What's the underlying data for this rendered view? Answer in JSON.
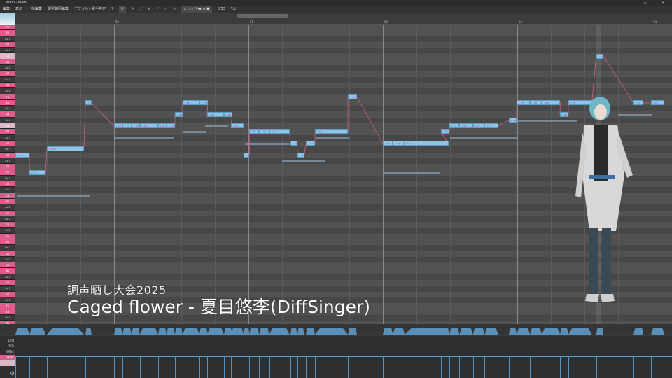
{
  "window": {
    "title": "Main - Main",
    "minimize": "–",
    "maximize": "❐",
    "close": "✕"
  },
  "toolbar": {
    "menus": [
      "編集",
      "表示",
      "一括編集",
      "選択範囲編集",
      "デフォルト歌手設定"
    ],
    "tools": [
      "?",
      "⇱",
      "✎",
      "⟋",
      "✐",
      "⟋",
      "⟋",
      "✎"
    ],
    "group": [
      "♫",
      "▭",
      "⟋",
      "/",
      "▬",
      "⋀",
      "▣"
    ],
    "counter": "0/33",
    "extra": "½♪"
  },
  "ruler": {
    "bars": [
      "50",
      "51",
      "52",
      "53",
      "54"
    ]
  },
  "keys": [
    "F5",
    "E5",
    "D#5",
    "D5",
    "C#5",
    "C5",
    "B4",
    "A#4",
    "A4",
    "G#4",
    "G4",
    "F#4",
    "F4",
    "E4",
    "D#4",
    "D4",
    "C#4",
    "C4",
    "B3",
    "A#3",
    "A3",
    "G#3",
    "G3",
    "F#3",
    "F3",
    "E3",
    "D#3",
    "D3",
    "C#3",
    "C3",
    "B2",
    "A#2",
    "A2",
    "G#2",
    "G2",
    "F#2",
    "F2",
    "E2",
    "D#2",
    "D2",
    "C#2",
    "C2",
    "B1",
    "A#1",
    "A1",
    "G#1",
    "G1",
    "F#1",
    "F1",
    "E1",
    "D#1",
    "D1",
    "C#1"
  ],
  "notes": [
    {
      "pitch": "G3",
      "start": -2.94,
      "len": 0.42
    },
    {
      "pitch": "E3",
      "start": -2.52,
      "len": 0.48
    },
    {
      "pitch": "G#3",
      "start": -2.0,
      "len": 1.1
    },
    {
      "pitch": "E4",
      "start": -0.85,
      "len": 0.18
    },
    {
      "pitch": "C4",
      "start": 0.0,
      "len": 0.25
    },
    {
      "pitch": "C4",
      "start": 0.25,
      "len": 0.27
    },
    {
      "pitch": "C4",
      "start": 0.52,
      "len": 0.25
    },
    {
      "pitch": "C4",
      "start": 0.77,
      "len": 0.54
    },
    {
      "pitch": "C4",
      "start": 1.31,
      "len": 0.25
    },
    {
      "pitch": "C4",
      "start": 1.56,
      "len": 0.25
    },
    {
      "pitch": "D4",
      "start": 1.81,
      "len": 0.23
    },
    {
      "pitch": "E4",
      "start": 2.04,
      "len": 0.5
    },
    {
      "pitch": "E4",
      "start": 2.54,
      "len": 0.25
    },
    {
      "pitch": "D4",
      "start": 2.77,
      "len": 0.5
    },
    {
      "pitch": "D4",
      "start": 3.27,
      "len": 0.25
    },
    {
      "pitch": "C4",
      "start": 3.48,
      "len": 0.38
    },
    {
      "pitch": "G3",
      "start": 3.86,
      "len": 0.17
    },
    {
      "pitch": "B3",
      "start": 4.02,
      "len": 0.3
    },
    {
      "pitch": "B3",
      "start": 4.32,
      "len": 0.3
    },
    {
      "pitch": "B3",
      "start": 4.62,
      "len": 0.6
    },
    {
      "pitch": "A3",
      "start": 5.25,
      "len": 0.2
    },
    {
      "pitch": "G3",
      "start": 5.46,
      "len": 0.2
    },
    {
      "pitch": "A3",
      "start": 5.71,
      "len": 0.27
    },
    {
      "pitch": "B3",
      "start": 5.98,
      "len": 0.98
    },
    {
      "pitch": "F4",
      "start": 6.96,
      "len": 0.27
    },
    {
      "pitch": "A3",
      "start": 8.0,
      "len": 0.3
    },
    {
      "pitch": "A3",
      "start": 8.3,
      "len": 0.35
    },
    {
      "pitch": "A3",
      "start": 8.65,
      "len": 1.3
    },
    {
      "pitch": "B3",
      "start": 9.73,
      "len": 0.25
    },
    {
      "pitch": "C4",
      "start": 9.98,
      "len": 0.3
    },
    {
      "pitch": "C4",
      "start": 10.28,
      "len": 0.4
    },
    {
      "pitch": "C4",
      "start": 10.68,
      "len": 0.35
    },
    {
      "pitch": "C4",
      "start": 11.03,
      "len": 0.4
    },
    {
      "pitch": "C#4",
      "start": 11.75,
      "len": 0.23
    },
    {
      "pitch": "E4",
      "start": 11.98,
      "len": 0.4
    },
    {
      "pitch": "E4",
      "start": 12.38,
      "len": 0.35
    },
    {
      "pitch": "E4",
      "start": 12.73,
      "len": 0.55
    },
    {
      "pitch": "D4",
      "start": 13.27,
      "len": 0.25
    },
    {
      "pitch": "E4",
      "start": 13.52,
      "len": 0.7
    },
    {
      "pitch": "C5",
      "start": 14.35,
      "len": 0.22
    },
    {
      "pitch": "E4",
      "start": 15.46,
      "len": 0.3
    },
    {
      "pitch": "E4",
      "start": 15.98,
      "len": 0.4
    }
  ],
  "reference_notes": [
    {
      "pitch": "C3",
      "start": -2.9,
      "len": 2.2
    },
    {
      "pitch": "A#3",
      "start": 0.0,
      "len": 1.8
    },
    {
      "pitch": "B3",
      "start": 2.04,
      "len": 0.7
    },
    {
      "pitch": "C4",
      "start": 2.7,
      "len": 0.7
    },
    {
      "pitch": "A3",
      "start": 3.9,
      "len": 1.3
    },
    {
      "pitch": "F#3",
      "start": 5.0,
      "len": 1.3
    },
    {
      "pitch": "A#3",
      "start": 6.0,
      "len": 1.0
    },
    {
      "pitch": "E3",
      "start": 8.0,
      "len": 1.7
    },
    {
      "pitch": "A#3",
      "start": 10.0,
      "len": 2.0
    },
    {
      "pitch": "C#4",
      "start": 12.0,
      "len": 1.8
    },
    {
      "pitch": "D4",
      "start": 15.0,
      "len": 1.0
    }
  ],
  "overlay": {
    "subtitle": "調声晒し大会2025",
    "title": "Caged flower - 夏目悠李(DiffSinger)"
  },
  "params": {
    "labels": [
      "DYN",
      "PITD",
      "BREC",
      "TENC",
      "VEL"
    ],
    "active": "TENC"
  },
  "note_track_lyrics": [
    "a",
    "a",
    "k",
    "u",
    "SP",
    "k",
    "i",
    "t",
    "o",
    "a",
    "SP",
    "o"
  ],
  "colors": {
    "accent": "#e05a8c",
    "note": "#8fc4e6",
    "curve": "#d0608c"
  }
}
